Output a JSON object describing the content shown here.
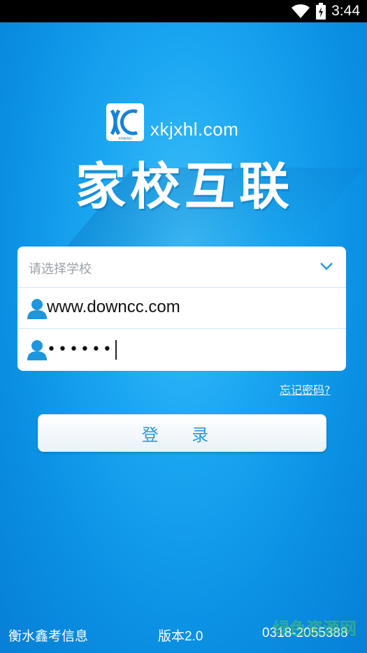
{
  "status_bar": {
    "time": "3:44",
    "icons": [
      "wifi-icon",
      "battery-icon"
    ]
  },
  "logo": {
    "url": "xkjxhl.com",
    "title": "家校互联",
    "mark_text": "XINKAO"
  },
  "form": {
    "school_select_placeholder": "请选择学校",
    "username_value": "www.downcc.com",
    "password_value": "••••••"
  },
  "forgot_password_label": "忘记密码?",
  "login_button_label": "登 录",
  "footer": {
    "company": "衡水鑫考信息",
    "version": "版本2.0",
    "phone": "0318-2055388"
  },
  "watermark": "绿色资源网",
  "colors": {
    "background": "#1aa6f1",
    "button_text": "#2b97df",
    "icon_blue": "#1e96de"
  }
}
